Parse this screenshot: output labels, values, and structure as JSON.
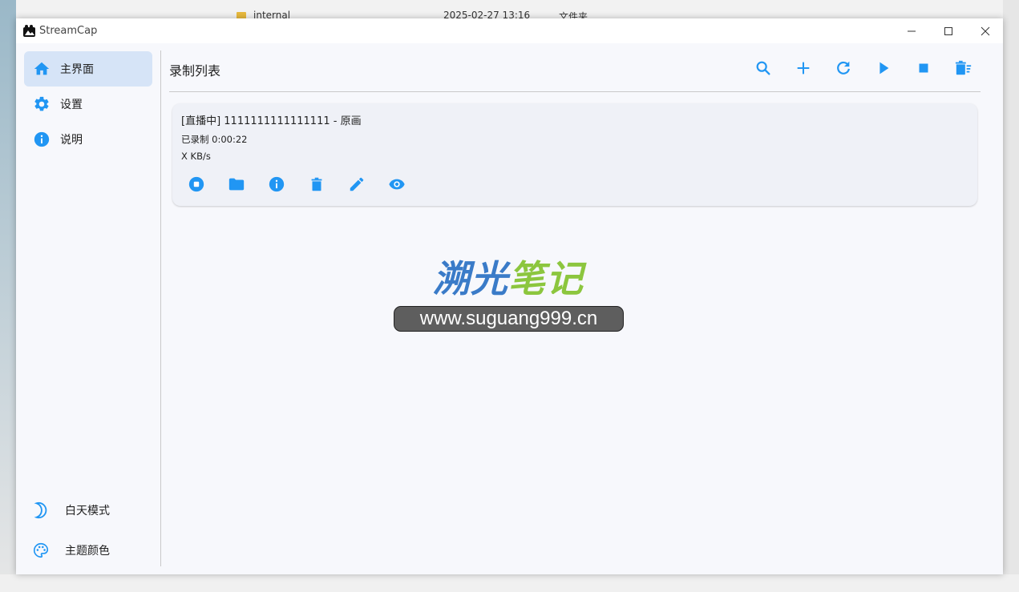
{
  "background": {
    "file_name": "internal",
    "date_text": "2025-02-27 13:16",
    "type_text": "文件夹"
  },
  "window": {
    "title": "StreamCap",
    "controls": [
      "minimize",
      "maximize",
      "close"
    ]
  },
  "sidebar": {
    "items": [
      {
        "label": "主界面",
        "icon": "home-icon",
        "active": true
      },
      {
        "label": "设置",
        "icon": "gear-icon",
        "active": false
      },
      {
        "label": "说明",
        "icon": "info-icon",
        "active": false
      }
    ],
    "bottom_items": [
      {
        "label": "白天模式",
        "icon": "moon-icon"
      },
      {
        "label": "主题颜色",
        "icon": "palette-icon"
      }
    ]
  },
  "main": {
    "title": "录制列表",
    "toolbar": [
      "search-icon",
      "add-icon",
      "refresh-icon",
      "play-icon",
      "stop-icon",
      "delete-list-icon"
    ],
    "cards": [
      {
        "title": "[直播中] 1111111111111111 - 原画",
        "recorded": "已录制 0:00:22",
        "speed": "X KB/s",
        "actions": [
          "stop-circle-icon",
          "folder-icon",
          "info-icon",
          "delete-icon",
          "edit-icon",
          "eye-icon"
        ]
      }
    ]
  },
  "watermark": {
    "title_part1": "溯光",
    "title_part2": "笔记",
    "url": "www.suguang999.cn"
  },
  "colors": {
    "accent": "#2196f3",
    "active_nav": "#d6e4f7",
    "background": "#f7f8fc",
    "card": "#eff1f7"
  }
}
